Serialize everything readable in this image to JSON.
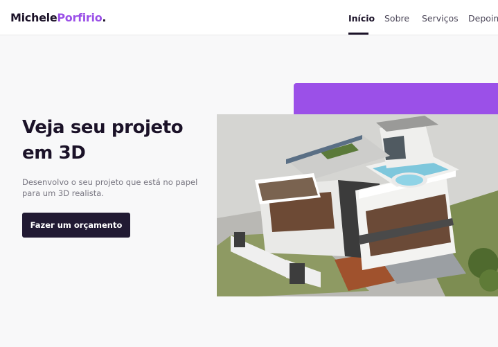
{
  "header": {
    "logo": {
      "first": "Michele",
      "last": "Porfirio",
      "dot": "."
    },
    "nav": [
      {
        "label": "Início",
        "active": true
      },
      {
        "label": "Sobre",
        "active": false
      },
      {
        "label": "Serviços",
        "active": false
      },
      {
        "label": "Depoim",
        "active": false
      }
    ]
  },
  "hero": {
    "title": "Veja seu projeto em 3D",
    "subtitle": "Desenvolvo o seu projeto que está no papel para um 3D realista.",
    "cta_label": "Fazer um orçamento"
  },
  "colors": {
    "accent": "#9b50e8",
    "dark": "#211a33",
    "text": "#1b1228",
    "muted": "#777580",
    "background": "#f8f8f9"
  }
}
